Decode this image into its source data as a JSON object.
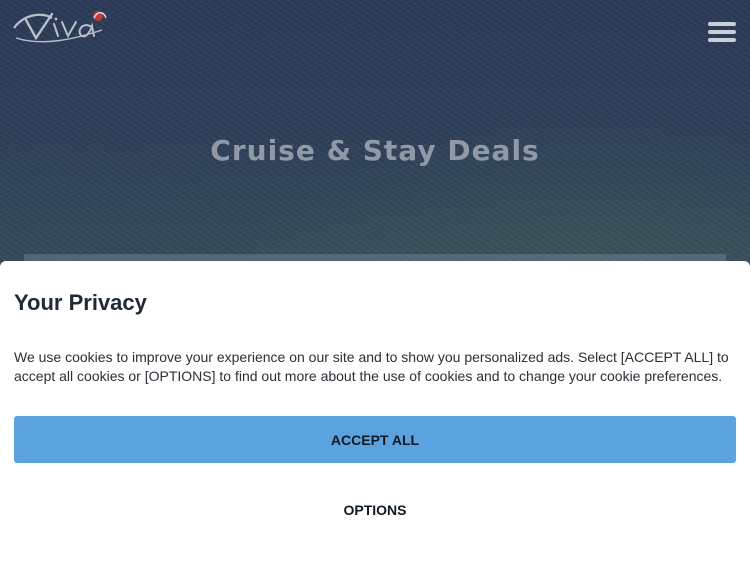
{
  "header": {
    "logo_alt": "Viva Cruise",
    "menu_icon": "hamburger-menu-icon"
  },
  "hero": {
    "title": "Cruise & Stay Deals"
  },
  "privacy": {
    "title": "Your Privacy",
    "text": "We use cookies to improve your experience on our site and to show you personalized ads. Select [ACCEPT ALL] to accept all cookies or [OPTIONS] to find out more about the use of cookies and to change your cookie preferences.",
    "accept_label": "ACCEPT ALL",
    "options_label": "OPTIONS"
  },
  "colors": {
    "accent": "#5ba3de",
    "dialog_bg": "#ffffff",
    "title_text": "#1f2a36"
  }
}
